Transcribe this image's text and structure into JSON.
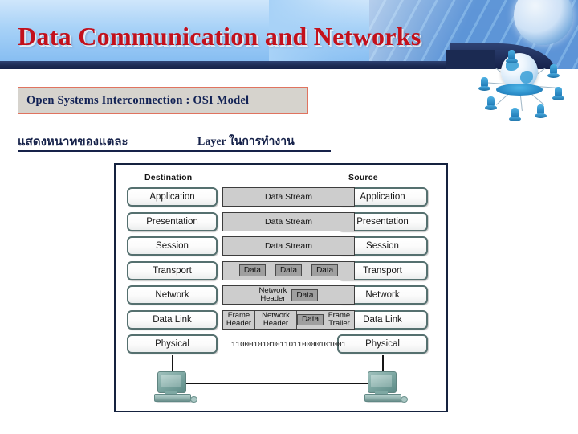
{
  "header": {
    "title": "Data Communication and Networks",
    "title_color": "#c3101b",
    "banner_color": "#16224a",
    "background_color": "#8ec2f3",
    "keyboard_image": "keyboard-photo",
    "globe_image": "globe-network-graphic"
  },
  "topic_box": {
    "label": "Open Systems Interconnection : OSI Model",
    "background_color": "#d6d3cd",
    "border_color": "#e0735f",
    "text_color": "#122255"
  },
  "subtitle": {
    "thai_text": "แสดงหนาทของแตละ",
    "english_text": "Layer ในการทำงาน",
    "text_color": "#16224a"
  },
  "diagram": {
    "name": "osi-model-encapsulation-diagram",
    "border_color": "#15223f",
    "column_headers": {
      "left": "Destination",
      "right": "Source"
    },
    "layers": [
      {
        "left": "Application",
        "right": "Application",
        "middle_type": "text",
        "middle": "Data Stream"
      },
      {
        "left": "Presentation",
        "right": "Presentation",
        "middle_type": "text",
        "middle": "Data Stream"
      },
      {
        "left": "Session",
        "right": "Session",
        "middle_type": "text",
        "middle": "Data Stream"
      },
      {
        "left": "Transport",
        "right": "Transport",
        "middle_type": "chips",
        "middle_chips": [
          "Data",
          "Data",
          "Data"
        ]
      },
      {
        "left": "Network",
        "right": "Network",
        "middle_type": "header_data",
        "middle_header": "Network Header",
        "middle_data": "Data"
      },
      {
        "left": "Data Link",
        "right": "Data Link",
        "middle_type": "frame",
        "middle_cells": [
          "Frame Header",
          "Network Header",
          "Data",
          "Frame Trailer"
        ]
      },
      {
        "left": "Physical",
        "right": "Physical",
        "middle_type": "binary",
        "middle": "11000101010110110000101001"
      }
    ],
    "devices": {
      "left": "destination-computer",
      "right": "source-computer",
      "link": "network-cable"
    }
  }
}
